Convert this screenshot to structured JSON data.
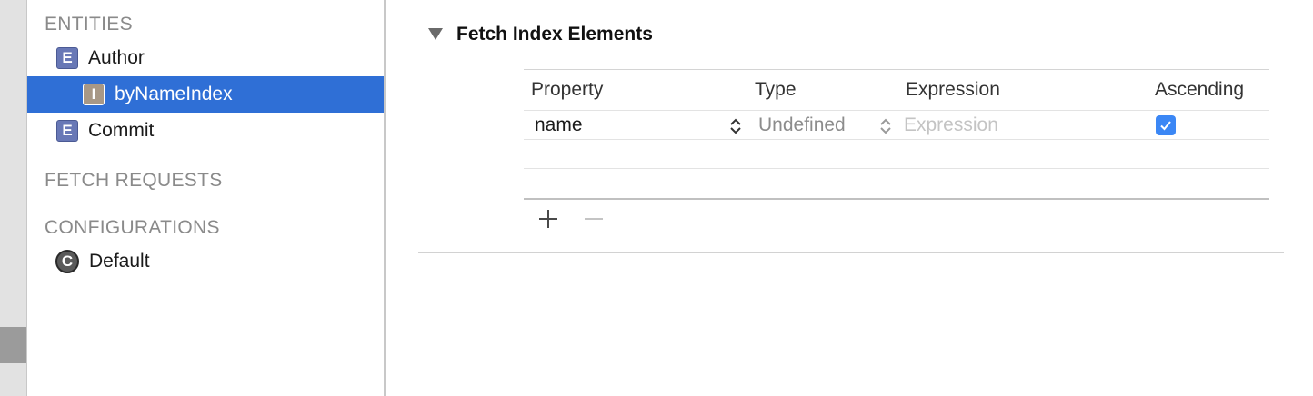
{
  "sidebar": {
    "sections": [
      {
        "title": "ENTITIES"
      },
      {
        "title": "FETCH REQUESTS"
      },
      {
        "title": "CONFIGURATIONS"
      }
    ],
    "entities": [
      {
        "badge": "E",
        "label": "Author"
      },
      {
        "badge": "I",
        "label": "byNameIndex",
        "selected": true
      },
      {
        "badge": "E",
        "label": "Commit"
      }
    ],
    "configurations": [
      {
        "badge": "C",
        "label": "Default"
      }
    ]
  },
  "panel": {
    "title": "Fetch Index Elements",
    "columns": [
      "Property",
      "Type",
      "Expression",
      "Ascending"
    ],
    "rows": [
      {
        "property": "name",
        "type": "Undefined",
        "expression_placeholder": "Expression",
        "ascending": true
      }
    ]
  },
  "colors": {
    "selection": "#2f6fd6",
    "entity_badge": "#6878b6",
    "index_badge": "#a89886",
    "checkbox": "#3b87f5"
  }
}
